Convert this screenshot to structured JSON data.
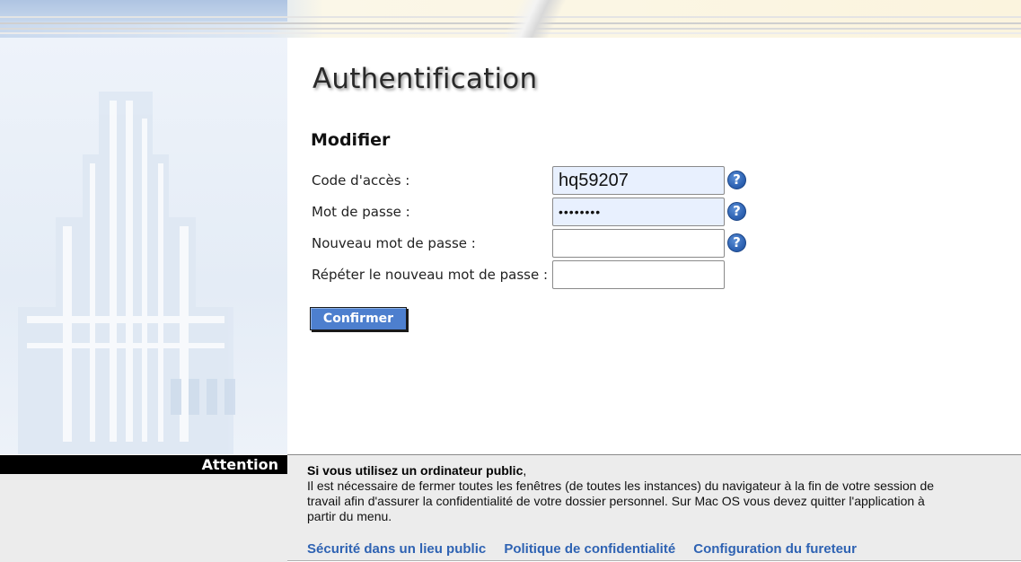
{
  "page": {
    "title": "Authentification",
    "section_title": "Modifier"
  },
  "form": {
    "fields": [
      {
        "label": "Code d'accès :",
        "value": "hq59207",
        "filled": true
      },
      {
        "label": "Mot de passe :",
        "value": "••••••••",
        "filled": true
      },
      {
        "label": "Nouveau mot de passe :",
        "value": "",
        "filled": false
      },
      {
        "label": "Répéter le nouveau mot de passe :",
        "value": "",
        "filled": false
      }
    ],
    "help_icon": "?",
    "confirm_label": "Confirmer"
  },
  "attention": {
    "label": "Attention",
    "heading_bold": "Si vous utilisez un ordinateur public",
    "heading_tail": ",",
    "text": "Il est nécessaire de fermer toutes les fenêtres (de toutes les instances) du navigateur à la fin de votre session de travail afin d'assurer la confidentialité de votre dossier personnel. Sur Mac OS vous devez quitter l'application à partir du menu.",
    "links": [
      "Sécurité dans un lieu public",
      "Politique de confidentialité",
      "Configuration du fureteur"
    ]
  },
  "colors": {
    "accent": "#4d7fce",
    "link": "#2f63b3",
    "help_icon": "#2f64b4",
    "filled_field": "#e8f0fe"
  }
}
